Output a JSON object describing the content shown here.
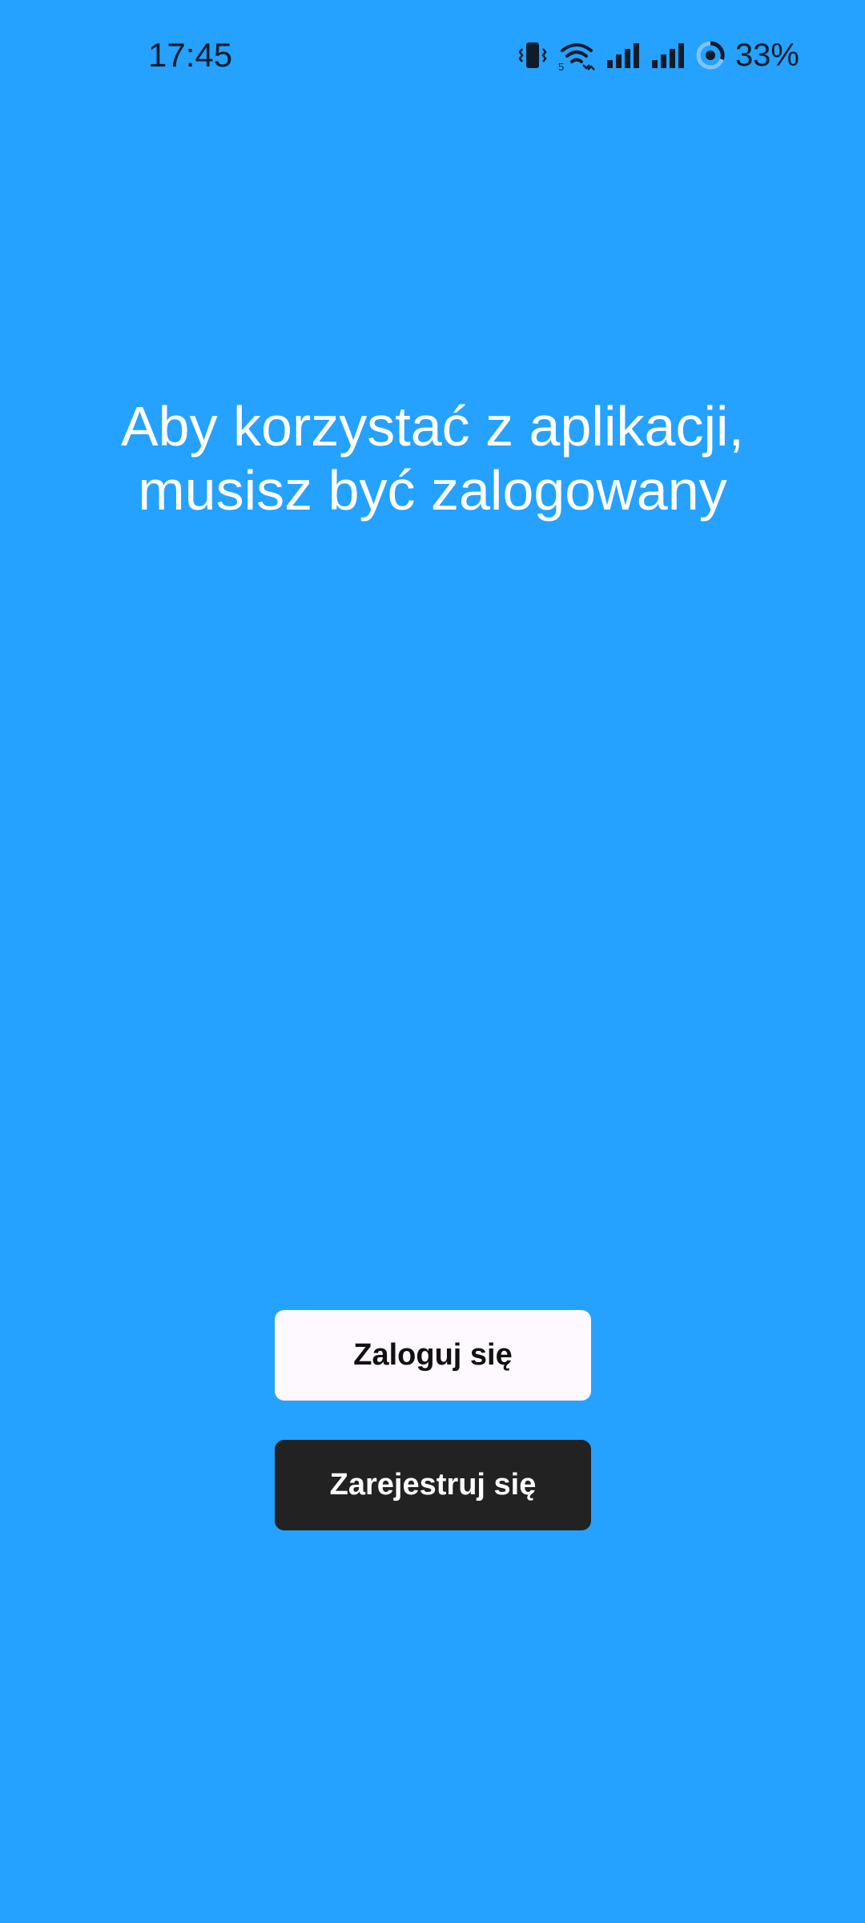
{
  "status_bar": {
    "time": "17:45",
    "battery_percent": "33%",
    "icons": [
      "vibrate-icon",
      "wifi-icon",
      "signal-icon",
      "signal-icon",
      "battery-ring-icon"
    ],
    "wifi_badge": "5"
  },
  "main": {
    "message_line1": "Aby korzystać z aplikacji,",
    "message_line2": "musisz być zalogowany"
  },
  "buttons": {
    "login_label": "Zaloguj się",
    "register_label": "Zarejestruj się"
  },
  "colors": {
    "background": "#25A2FF",
    "login_button_bg": "#FEF9FF",
    "register_button_bg": "#222222",
    "status_text": "#0E1C2B"
  }
}
